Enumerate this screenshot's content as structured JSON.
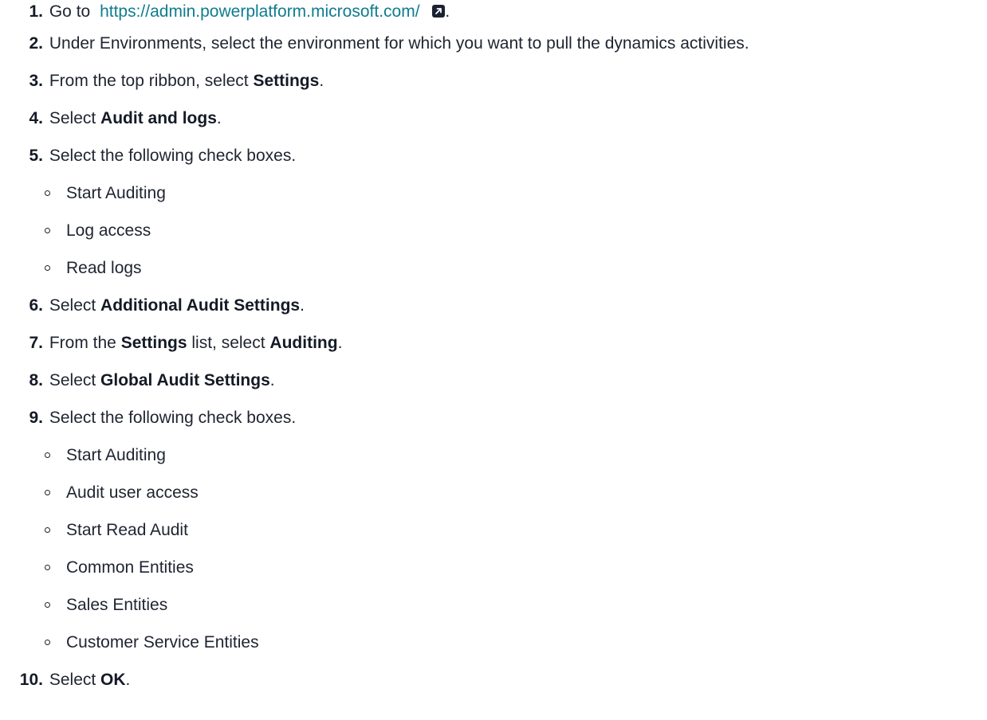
{
  "steps": [
    {
      "num": "1.",
      "pre": "Go to",
      "link": "https://admin.powerplatform.microsoft.com/",
      "post": "."
    },
    {
      "num": "2.",
      "text": "Under Environments, select the environment for which you want to pull the dynamics activities."
    },
    {
      "num": "3.",
      "pre": "From the top ribbon, select ",
      "bold": "Settings",
      "post": "."
    },
    {
      "num": "4.",
      "pre": "Select ",
      "bold": "Audit and logs",
      "post": "."
    },
    {
      "num": "5.",
      "text": "Select the following check boxes.",
      "sub": [
        "Start Auditing",
        "Log access",
        "Read logs"
      ]
    },
    {
      "num": "6.",
      "pre": "Select ",
      "bold": "Additional Audit Settings",
      "post": "."
    },
    {
      "num": "7.",
      "pre": "From the ",
      "bold": "Settings",
      "mid": " list, select ",
      "bold2": "Auditing",
      "post": "."
    },
    {
      "num": "8.",
      "pre": "Select ",
      "bold": "Global Audit Settings",
      "post": "."
    },
    {
      "num": "9.",
      "text": "Select the following check boxes.",
      "sub": [
        "Start Auditing",
        "Audit user access",
        "Start Read Audit",
        "Common Entities",
        "Sales Entities",
        "Customer Service Entities"
      ]
    },
    {
      "num": "10.",
      "pre": "Select ",
      "bold": "OK",
      "post": "."
    }
  ],
  "icons": {
    "external_link": "external-link-icon"
  },
  "colors": {
    "link": "#0f7c8f",
    "text": "#1f2430",
    "icon_bg": "#1b2233"
  }
}
